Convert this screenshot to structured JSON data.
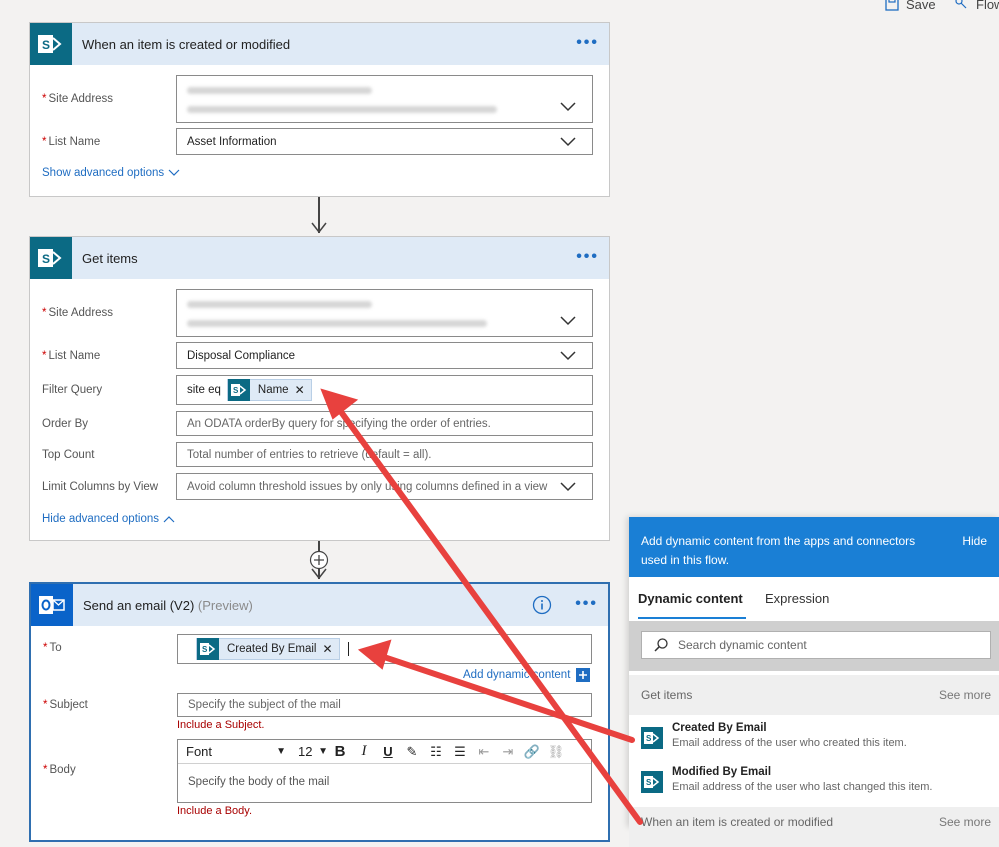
{
  "toolbar": {
    "save_label": "Save",
    "flow_label": "Flow"
  },
  "trigger_card": {
    "title": "When an item is created or modified",
    "site_address_label": "Site Address",
    "list_name_label": "List Name",
    "list_name_value": "Asset Information",
    "advanced_link": "Show advanced options"
  },
  "get_items_card": {
    "title": "Get items",
    "site_address_label": "Site Address",
    "list_name_label": "List Name",
    "list_name_value": "Disposal Compliance",
    "filter_query_label": "Filter Query",
    "filter_query_prefix": "site eq",
    "filter_token": "Name",
    "order_by_label": "Order By",
    "order_by_placeholder": "An ODATA orderBy query for specifying the order of entries.",
    "top_count_label": "Top Count",
    "top_count_placeholder": "Total number of entries to retrieve (default = all).",
    "limit_columns_label": "Limit Columns by View",
    "limit_columns_placeholder": "Avoid column threshold issues by only using columns defined in a view",
    "advanced_link": "Hide advanced options"
  },
  "email_card": {
    "title": "Send an email (V2)",
    "title_suffix": "(Preview)",
    "to_label": "To",
    "to_token": "Created By Email",
    "add_dynamic": "Add dynamic content",
    "subject_label": "Subject",
    "subject_placeholder": "Specify the subject of the mail",
    "subject_error": "Include a Subject.",
    "body_label": "Body",
    "font_label": "Font",
    "font_size": "12",
    "body_placeholder": "Specify the body of the mail",
    "body_error": "Include a Body."
  },
  "dynamic_panel": {
    "header_text": "Add dynamic content from the apps and connectors used in this flow.",
    "hide_label": "Hide",
    "tab_dynamic": "Dynamic content",
    "tab_expression": "Expression",
    "search_placeholder": "Search dynamic content",
    "section1_title": "Get items",
    "section1_see_more": "See more",
    "items": [
      {
        "name": "Created By Email",
        "desc": "Email address of the user who created this item."
      },
      {
        "name": "Modified By Email",
        "desc": "Email address of the user who last changed this item."
      }
    ],
    "section2_title": "When an item is created or modified",
    "section2_see_more": "See more"
  },
  "colors": {
    "accent": "#1a7fd5",
    "sharepoint": "#0b6a84",
    "outlook": "#0a63c9",
    "arrow": "#e8413e",
    "error": "#a80000"
  }
}
